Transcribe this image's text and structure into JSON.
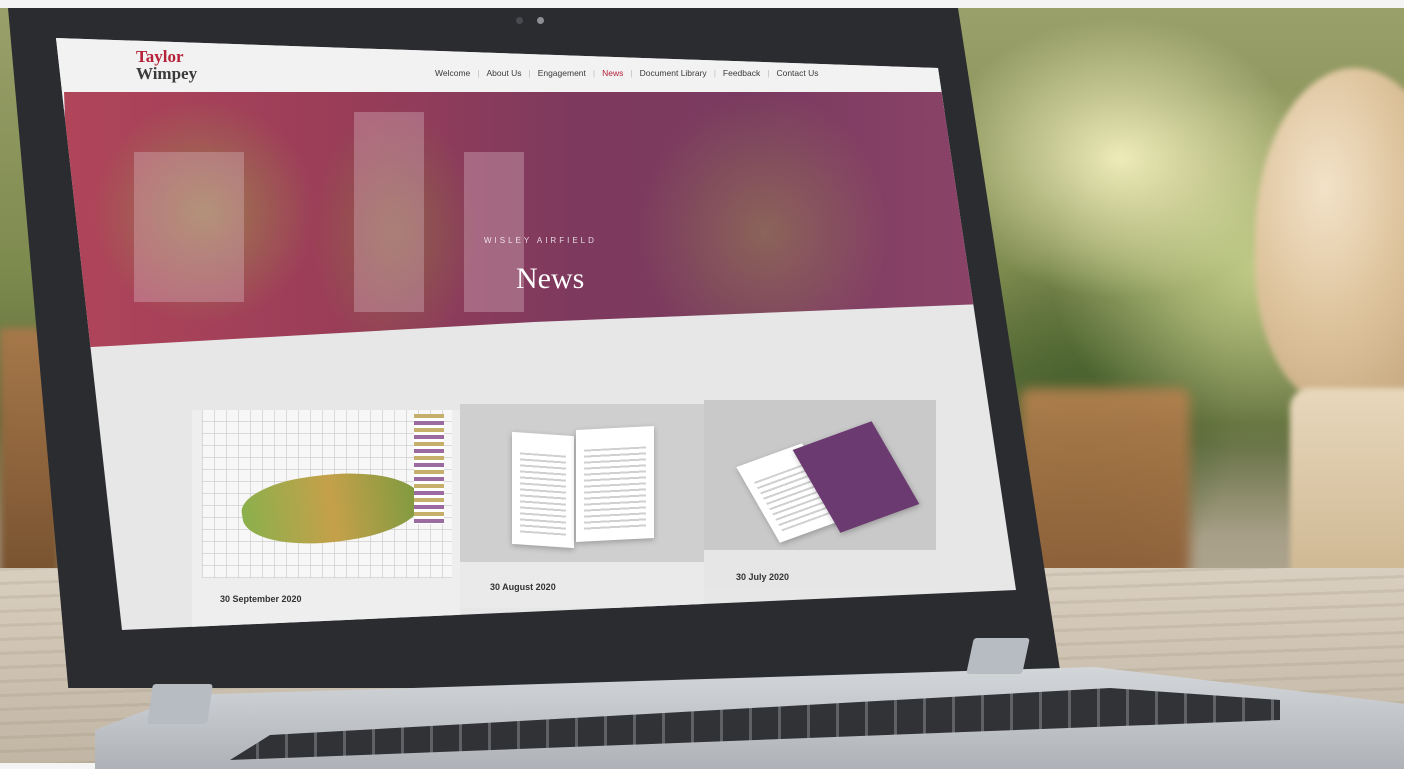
{
  "site": {
    "logo_top": "Taylor",
    "logo_bottom": "Wimpey"
  },
  "nav": {
    "items": [
      {
        "label": "Welcome",
        "active": false
      },
      {
        "label": "About Us",
        "active": false
      },
      {
        "label": "Engagement",
        "active": false
      },
      {
        "label": "News",
        "active": true
      },
      {
        "label": "Document Library",
        "active": false
      },
      {
        "label": "Feedback",
        "active": false
      },
      {
        "label": "Contact Us",
        "active": false
      }
    ]
  },
  "hero": {
    "subtitle": "WISLEY AIRFIELD",
    "title": "News"
  },
  "news_cards": [
    {
      "date": "30 September 2020"
    },
    {
      "date": "30 August 2020"
    },
    {
      "date": "30 July 2020"
    }
  ],
  "colors": {
    "brand_red": "#b5223a",
    "hero_overlay": "#8c3a5e"
  }
}
